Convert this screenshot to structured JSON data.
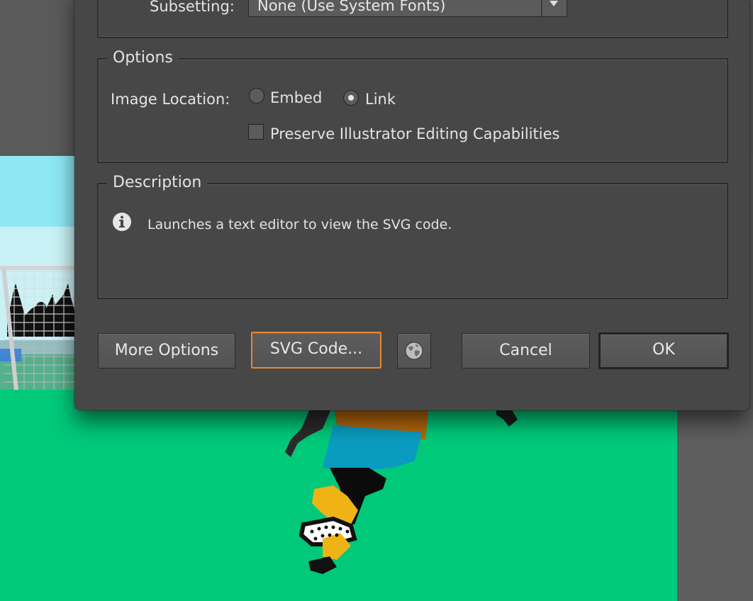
{
  "dialog": {
    "subsetting": {
      "label": "Subsetting:",
      "value": "None (Use System Fonts)"
    },
    "options": {
      "legend": "Options",
      "image_location_label": "Image Location:",
      "embed_label": "Embed",
      "link_label": "Link",
      "selected": "Link",
      "preserve_label": "Preserve Illustrator Editing Capabilities",
      "preserve_checked": false
    },
    "description": {
      "legend": "Description",
      "text": "Launches a text editor to view the SVG code."
    },
    "buttons": {
      "more_options": "More Options",
      "svg_code": "SVG Code...",
      "cancel": "Cancel",
      "ok": "OK"
    }
  },
  "colors": {
    "dialog_bg": "#474747",
    "focus_ring": "#e8892c",
    "artboard_green": "#00c97a",
    "sky": "#8ee8f4"
  },
  "icons": [
    "chevron-down-icon",
    "info-icon",
    "globe-icon"
  ]
}
